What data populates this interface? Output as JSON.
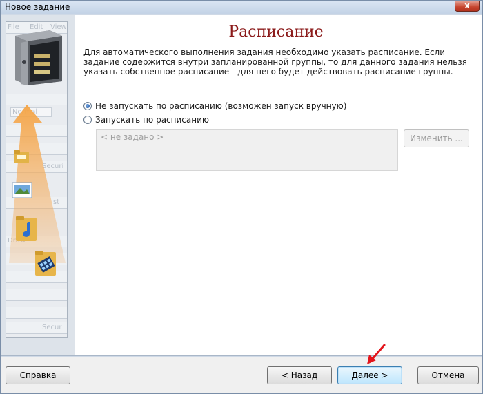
{
  "window": {
    "title": "Новое задание",
    "close_icon": "close-icon",
    "close_glyph": "x"
  },
  "side_panel": {
    "ghost_toolbar_texts": [
      "File",
      "Edit",
      "View"
    ],
    "ghost_field_text": "Normal",
    "ghost_secure_texts": [
      "Securi",
      "Secur"
    ],
    "ghost_draw_text": "Draw",
    "ghost_extra_text": "st",
    "icons": [
      "safe-icon",
      "orange-arrow-icon",
      "folder-icon",
      "image-file-icon",
      "music-folder-icon",
      "video-folder-icon"
    ]
  },
  "main": {
    "heading": "Расписание",
    "description": "Для автоматического выполнения задания необходимо указать расписание. Если задание содержится внутри запланированной группы, то для данного задания нельзя указать собственное расписание - для него будет действовать расписание группы.",
    "options": [
      {
        "label": "Не запускать по расписанию (возможен запуск вручную)",
        "checked": true
      },
      {
        "label": "Запускать по расписанию",
        "checked": false
      }
    ],
    "schedule_value": "< не задано >",
    "change_button": "Изменить ..."
  },
  "footer": {
    "help_button": "Справка",
    "back_button": "< Назад",
    "next_button": "Далее >",
    "cancel_button": "Отмена"
  },
  "colors": {
    "heading": "#8b1a1a",
    "annotation_arrow": "#e3141b",
    "side_arrow": "#f29633"
  }
}
